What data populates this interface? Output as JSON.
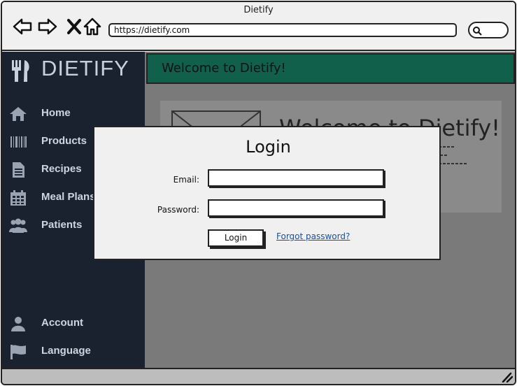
{
  "browser": {
    "title": "Dietify",
    "url": "https://dietify.com"
  },
  "sidebar": {
    "brand": "DIETIFY",
    "items": [
      {
        "label": "Home",
        "icon": "home-icon"
      },
      {
        "label": "Products",
        "icon": "barcode-icon"
      },
      {
        "label": "Recipes",
        "icon": "document-icon"
      },
      {
        "label": "Meal Plans",
        "icon": "calendar-icon"
      },
      {
        "label": "Patients",
        "icon": "users-icon"
      }
    ],
    "bottom_items": [
      {
        "label": "Account",
        "icon": "user-icon"
      },
      {
        "label": "Language",
        "icon": "flag-icon"
      }
    ]
  },
  "main": {
    "banner": "Welcome to Dietify!",
    "card_title": "Welcome to Dietify!"
  },
  "login": {
    "title": "Login",
    "email_label": "Email:",
    "email_value": "",
    "password_label": "Password:",
    "password_value": "",
    "button": "Login",
    "forgot": "Forgot password?"
  },
  "colors": {
    "sidebar_bg": "#1a2230",
    "banner_bg": "#10604c",
    "overlay_gray": "#7a7a7a",
    "link": "#1a4fa0"
  }
}
